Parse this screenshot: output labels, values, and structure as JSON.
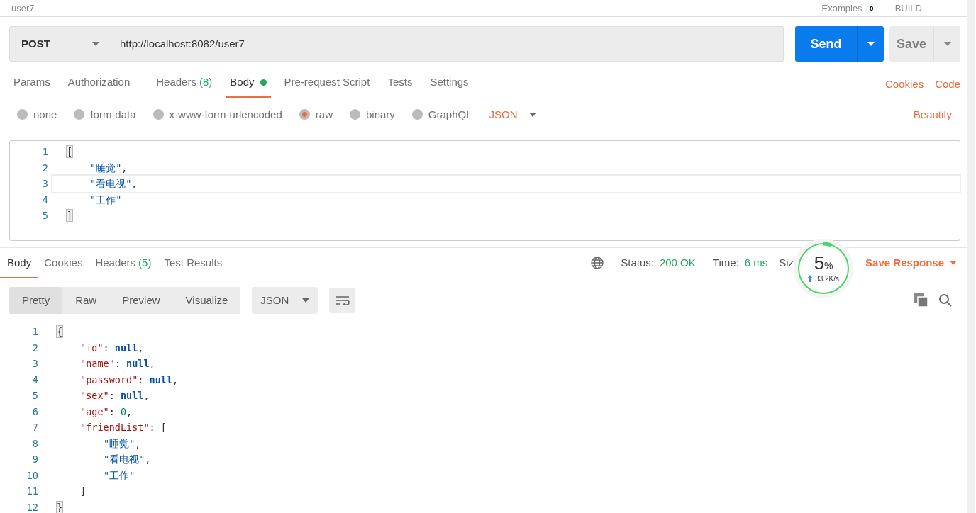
{
  "top_bar": {
    "request_name": "user7",
    "examples": "Examples",
    "examples_count": "0",
    "build": "BUILD"
  },
  "request": {
    "method": "POST",
    "url": "http://localhost:8082/user7",
    "send": "Send",
    "save": "Save"
  },
  "request_tabs": [
    {
      "label": "Params",
      "selected": false
    },
    {
      "label": "Authorization",
      "selected": false
    },
    {
      "label": "Headers",
      "count": "(8)",
      "selected": false
    },
    {
      "label": "Body",
      "dot": true,
      "selected": true
    },
    {
      "label": "Pre-request Script",
      "selected": false
    },
    {
      "label": "Tests",
      "selected": false
    },
    {
      "label": "Settings",
      "selected": false
    }
  ],
  "request_links": [
    "Cookies",
    "Code"
  ],
  "body_types": [
    {
      "label": "none",
      "selected": false
    },
    {
      "label": "form-data",
      "selected": false
    },
    {
      "label": "x-www-form-urlencoded",
      "selected": false
    },
    {
      "label": "raw",
      "selected": true
    },
    {
      "label": "binary",
      "selected": false
    },
    {
      "label": "GraphQL",
      "selected": false
    }
  ],
  "body_format": "JSON",
  "beautify": "Beautify",
  "request_body": [
    {
      "number": "1",
      "tokens": [
        {
          "kind": "punct",
          "text": "[",
          "matched": true
        }
      ],
      "children": [
        {
          "number": "2",
          "tokens": [
            {
              "kind": "string",
              "text": "\"睡觉\""
            },
            {
              "kind": "punct",
              "text": ","
            }
          ]
        },
        {
          "number": "3",
          "active": true,
          "tokens": [
            {
              "kind": "string",
              "text": "\"看电视\""
            },
            {
              "kind": "punct",
              "text": ","
            }
          ]
        },
        {
          "number": "4",
          "tokens": [
            {
              "kind": "string",
              "text": "\"工作\""
            }
          ]
        }
      ]
    },
    {
      "number": "5",
      "tokens": [
        {
          "kind": "punct",
          "text": "]",
          "matched": true
        }
      ]
    }
  ],
  "response_tabs": [
    {
      "label": "Body",
      "selected": true
    },
    {
      "label": "Cookies",
      "selected": false
    },
    {
      "label": "Headers",
      "count": "(5)",
      "selected": false
    },
    {
      "label": "Test Results",
      "selected": false
    }
  ],
  "status": {
    "status_label": "Status:",
    "status": "200 OK",
    "time_label": "Time:",
    "time": "6 ms",
    "size_label": "Siz"
  },
  "save_response": "Save Response",
  "speed_widget": {
    "percent": "5",
    "unit": "%",
    "speed": "33.2K/s",
    "level": 0.05
  },
  "view_modes": [
    {
      "label": "Pretty",
      "selected": true
    },
    {
      "label": "Raw",
      "selected": false
    },
    {
      "label": "Preview",
      "selected": false
    },
    {
      "label": "Visualize",
      "selected": false
    }
  ],
  "response_format": "JSON",
  "response_body": [
    {
      "number": "1",
      "tokens": [
        {
          "kind": "punct",
          "text": "{",
          "matched": true
        }
      ],
      "children": [
        {
          "number": "2",
          "tokens": [
            {
              "kind": "key",
              "text": "\"id\""
            },
            {
              "kind": "punct",
              "text": ": "
            },
            {
              "kind": "null",
              "text": "null"
            },
            {
              "kind": "punct",
              "text": ","
            }
          ]
        },
        {
          "number": "3",
          "tokens": [
            {
              "kind": "key",
              "text": "\"name\""
            },
            {
              "kind": "punct",
              "text": ": "
            },
            {
              "kind": "null",
              "text": "null"
            },
            {
              "kind": "punct",
              "text": ","
            }
          ]
        },
        {
          "number": "4",
          "tokens": [
            {
              "kind": "key",
              "text": "\"password\""
            },
            {
              "kind": "punct",
              "text": ": "
            },
            {
              "kind": "null",
              "text": "null"
            },
            {
              "kind": "punct",
              "text": ","
            }
          ]
        },
        {
          "number": "5",
          "tokens": [
            {
              "kind": "key",
              "text": "\"sex\""
            },
            {
              "kind": "punct",
              "text": ": "
            },
            {
              "kind": "null",
              "text": "null"
            },
            {
              "kind": "punct",
              "text": ","
            }
          ]
        },
        {
          "number": "6",
          "tokens": [
            {
              "kind": "key",
              "text": "\"age\""
            },
            {
              "kind": "punct",
              "text": ": "
            },
            {
              "kind": "number",
              "text": "0"
            },
            {
              "kind": "punct",
              "text": ","
            }
          ]
        },
        {
          "number": "7",
          "tokens": [
            {
              "kind": "key",
              "text": "\"friendList\""
            },
            {
              "kind": "punct",
              "text": ": ["
            }
          ],
          "children": [
            {
              "number": "8",
              "tokens": [
                {
                  "kind": "string",
                  "text": "\"睡觉\""
                },
                {
                  "kind": "punct",
                  "text": ","
                }
              ]
            },
            {
              "number": "9",
              "tokens": [
                {
                  "kind": "string",
                  "text": "\"看电视\""
                },
                {
                  "kind": "punct",
                  "text": ","
                }
              ]
            },
            {
              "number": "10",
              "tokens": [
                {
                  "kind": "string",
                  "text": "\"工作\""
                }
              ]
            }
          ]
        },
        {
          "number": "11",
          "tokens": [
            {
              "kind": "punct",
              "text": "]"
            }
          ]
        }
      ]
    },
    {
      "number": "12",
      "tokens": [
        {
          "kind": "punct",
          "text": "}",
          "matched": true
        }
      ]
    }
  ]
}
